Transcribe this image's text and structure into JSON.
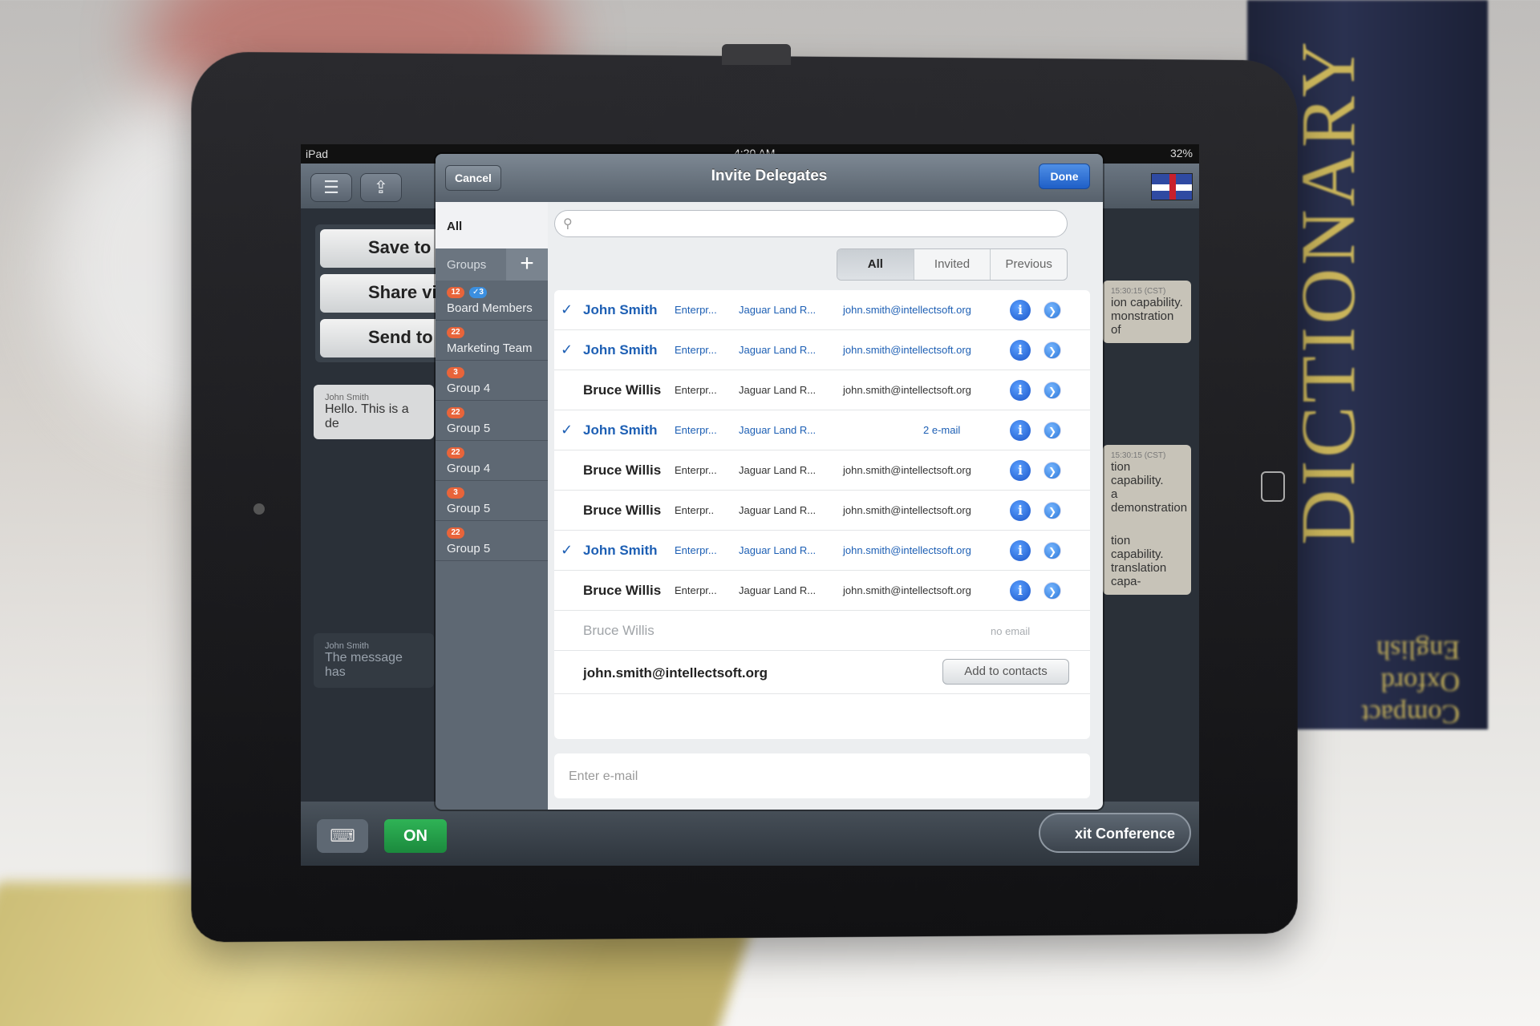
{
  "statusbar": {
    "device": "iPad",
    "time": "4:20 AM",
    "battery": "32%"
  },
  "toolbar": {
    "menu_icon": "☰",
    "share_icon": "⇪"
  },
  "share_menu": {
    "items": [
      {
        "label": "Save to"
      },
      {
        "label": "Share via"
      },
      {
        "label": "Send to yo"
      }
    ]
  },
  "chat": {
    "left_bubble": {
      "name": "John Smith",
      "text": "Hello. This is a de"
    },
    "dark_bubble": {
      "name": "John Smith",
      "text": "The message has"
    },
    "right_bubbles": [
      {
        "time": "15:30:15 (CST)",
        "line1": "ion capability.",
        "line2": "monstration of"
      },
      {
        "time": "15:30:15 (CST)",
        "line1": "tion capability.",
        "line2": "a demonstration",
        "line3": "tion capability.",
        "line4": "translation capa-"
      }
    ]
  },
  "bottom": {
    "keyboard_icon": "⌨",
    "on_label": "ON",
    "exit_label": "xit Conference"
  },
  "modal": {
    "title": "Invite Delegates",
    "cancel_label": "Cancel",
    "done_label": "Done",
    "groups": {
      "all_label": "All",
      "header_label": "Groups",
      "add_icon": "+",
      "items": [
        {
          "label": "Board Members",
          "badge": "12",
          "badge2": "✓3"
        },
        {
          "label": "Marketing Team",
          "badge": "22"
        },
        {
          "label": "Group 4",
          "badge": "3"
        },
        {
          "label": "Group 5",
          "badge": "22"
        },
        {
          "label": "Group 4",
          "badge": "22"
        },
        {
          "label": "Group 5",
          "badge": "3"
        },
        {
          "label": "Group 5",
          "badge": "22"
        }
      ]
    },
    "search": {
      "placeholder": ""
    },
    "segments": [
      "All",
      "Invited",
      "Previous"
    ],
    "contacts": [
      {
        "name": "John Smith",
        "org": "Enterpr...",
        "company": "Jaguar Land R...",
        "email": "john.smith@intellectsoft.org",
        "selected": true
      },
      {
        "name": "John Smith",
        "org": "Enterpr...",
        "company": "Jaguar Land R...",
        "email": "john.smith@intellectsoft.org",
        "selected": true
      },
      {
        "name": "Bruce Willis",
        "org": "Enterpr...",
        "company": "Jaguar Land R...",
        "email": "john.smith@intellectsoft.org",
        "selected": false
      },
      {
        "name": "John Smith",
        "org": "Enterpr...",
        "company": "Jaguar Land R...",
        "email_count": "2 e-mail",
        "selected": true
      },
      {
        "name": "Bruce Willis",
        "org": "Enterpr...",
        "company": "Jaguar Land R...",
        "email": "john.smith@intellectsoft.org",
        "selected": false
      },
      {
        "name": "Bruce Willis",
        "org": "Enterpr..",
        "company": "Jaguar Land R...",
        "email": "john.smith@intellectsoft.org",
        "selected": false
      },
      {
        "name": "John Smith",
        "org": "Enterpr...",
        "company": "Jaguar Land R...",
        "email": "john.smith@intellectsoft.org",
        "selected": true
      },
      {
        "name": "Bruce Willis",
        "org": "Enterpr...",
        "company": "Jaguar Land R...",
        "email": "john.smith@intellectsoft.org",
        "selected": false
      }
    ],
    "no_email_contact": {
      "name": "Bruce Willis",
      "note": "no email"
    },
    "new_email_row": {
      "email": "john.smith@intellectsoft.org",
      "button_label": "Add to contacts"
    },
    "email_input": {
      "placeholder": "Enter e-mail"
    }
  },
  "backdrop": {
    "book_title": "DICTIONARY",
    "book_sub": "Compact Oxford English"
  },
  "colors": {
    "accent_blue": "#1d5fb4",
    "badge_orange": "#e8643a",
    "on_green": "#2fb356"
  }
}
